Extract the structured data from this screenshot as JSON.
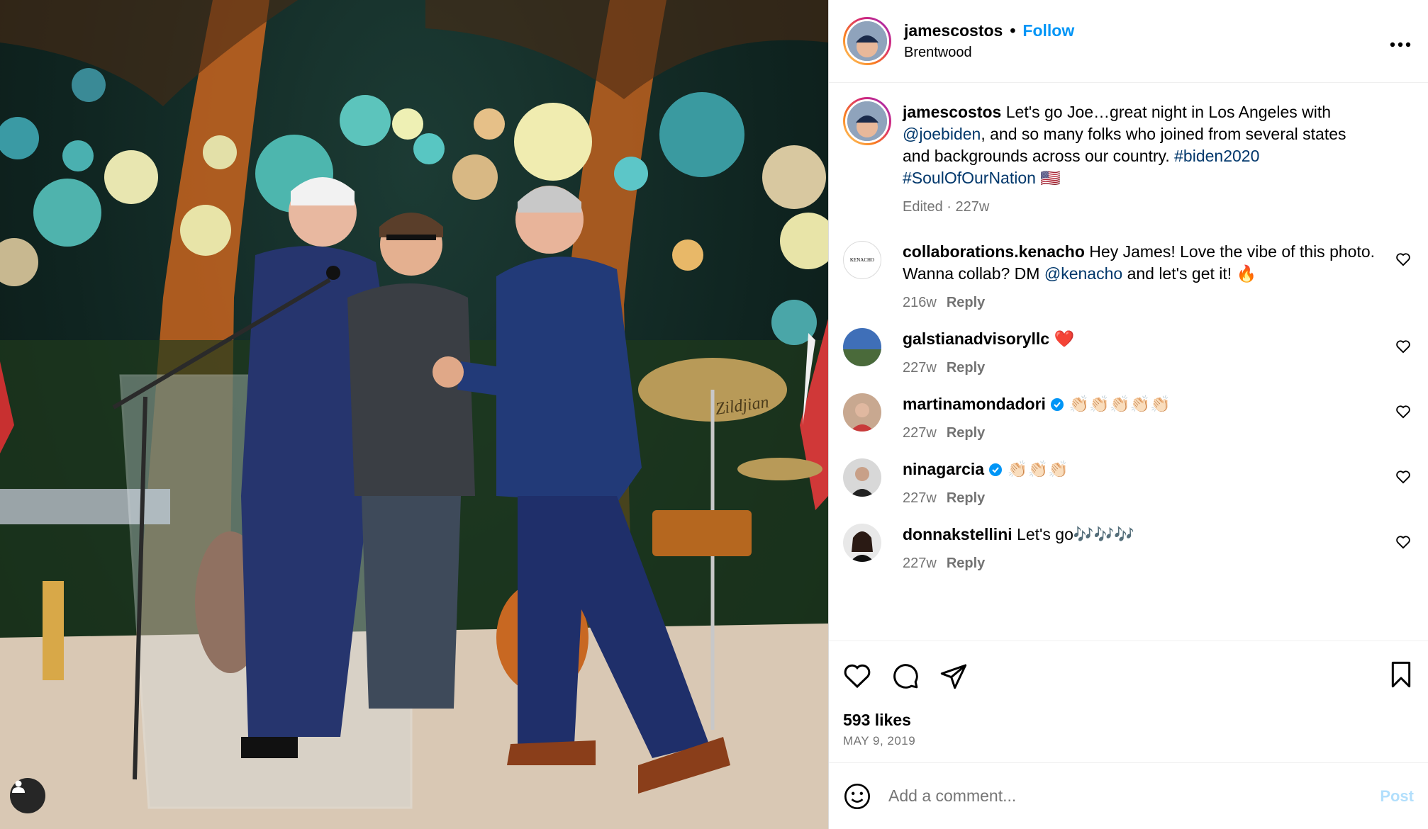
{
  "colors": {
    "accent": "#0095f6",
    "link": "#00376b",
    "muted": "#737373",
    "heart": "#ed4956",
    "post_disabled": "#b2dffc"
  },
  "header": {
    "username": "jamescostos",
    "separator": "•",
    "follow_label": "Follow",
    "location": "Brentwood",
    "more_icon": "more-horizontal-icon"
  },
  "caption": {
    "username": "jamescostos",
    "text_1": "Let's go Joe…great night in Los Angeles with",
    "mention": "@joebiden",
    "text_2": ", and so many folks who joined from several states and backgrounds across our country.",
    "hashtag_1": "#biden2020",
    "hashtag_2": "#SoulOfOurNation",
    "flag": "🇺🇸",
    "meta": "Edited · 227w"
  },
  "comments": [
    {
      "username": "collaborations.kenacho",
      "text_1": "Hey James! Love the vibe of this photo. Wanna collab? DM",
      "mention": "@kenacho",
      "text_2": "and let's get it! 🔥",
      "time": "216w",
      "reply": "Reply",
      "avatar_text": "KENACHO"
    },
    {
      "username": "galstianadvisoryllc",
      "text": "❤️",
      "time": "227w",
      "reply": "Reply"
    },
    {
      "username": "martinamondadori",
      "verified": true,
      "text": "👏🏻👏🏻👏🏻👏🏻👏🏻",
      "time": "227w",
      "reply": "Reply"
    },
    {
      "username": "ninagarcia",
      "verified": true,
      "text": "👏🏻👏🏻👏🏻",
      "time": "227w",
      "reply": "Reply"
    },
    {
      "username": "donnakstellini",
      "text": "Let's go🎶🎶🎶",
      "time": "227w",
      "reply": "Reply"
    }
  ],
  "stats": {
    "likes": "593 likes",
    "date": "MAY 9, 2019"
  },
  "add_comment": {
    "placeholder": "Add a comment...",
    "post_label": "Post"
  },
  "photo": {
    "cymbal_brand": "Zildjian"
  }
}
